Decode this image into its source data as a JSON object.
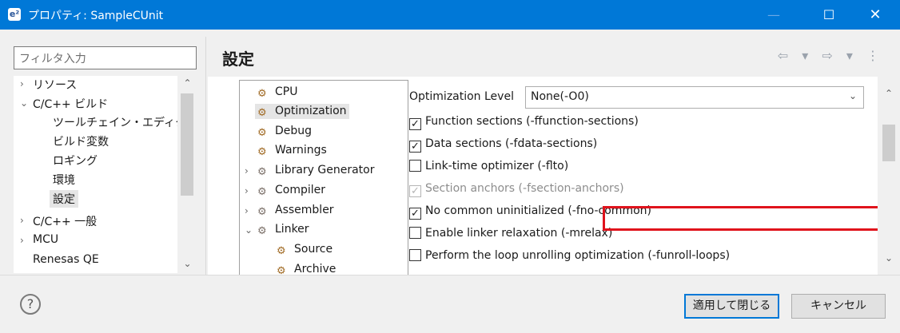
{
  "window": {
    "title": "プロパティ: SampleCUnit",
    "icon": "e²",
    "min": "—",
    "max": "☐",
    "close": "✕"
  },
  "filter": {
    "placeholder": "フィルタ入力"
  },
  "left_tree": [
    {
      "label": "リソース",
      "chev": "›"
    },
    {
      "label": "C/C++ ビルド",
      "chev": "⌄"
    },
    {
      "label": "ツールチェイン・エディター"
    },
    {
      "label": "ビルド変数"
    },
    {
      "label": "ロギング"
    },
    {
      "label": "環境"
    },
    {
      "label": "設定"
    },
    {
      "label": "C/C++ 一般",
      "chev": "›"
    },
    {
      "label": "MCU",
      "chev": "›"
    },
    {
      "label": "Renesas QE"
    }
  ],
  "header": {
    "title": "設定",
    "nav": "⇦ ▾ ⇨ ▾ ⋮"
  },
  "tool_tree": [
    {
      "label": "CPU"
    },
    {
      "label": "Optimization"
    },
    {
      "label": "Debug"
    },
    {
      "label": "Warnings"
    },
    {
      "label": "Library Generator",
      "chev": "›"
    },
    {
      "label": "Compiler",
      "chev": "›"
    },
    {
      "label": "Assembler",
      "chev": "›"
    },
    {
      "label": "Linker",
      "chev": "⌄"
    },
    {
      "label": "Source"
    },
    {
      "label": "Archive"
    }
  ],
  "options": {
    "level_label": "Optimization Level",
    "level_value": "None(-O0)",
    "checkboxes": [
      {
        "label": "Function sections (-ffunction-sections)",
        "checked": true
      },
      {
        "label": "Data sections (-fdata-sections)",
        "checked": true
      },
      {
        "label": "Link-time optimizer (-flto)",
        "checked": false
      },
      {
        "label": "Section anchors (-fsection-anchors)",
        "checked": true,
        "disabled": true
      },
      {
        "label": "No common uninitialized (-fno-common)",
        "checked": true
      },
      {
        "label": "Enable linker relaxation (-mrelax)",
        "checked": false
      },
      {
        "label": "Perform the loop unrolling optimization (-funroll-loops)",
        "checked": false
      }
    ],
    "check_mark": "✓"
  },
  "footer": {
    "help": "?",
    "apply": "適用して閉じる",
    "cancel": "キャンセル"
  },
  "colors": {
    "titlebar": "#0078d7",
    "highlight": "#e0131c"
  }
}
